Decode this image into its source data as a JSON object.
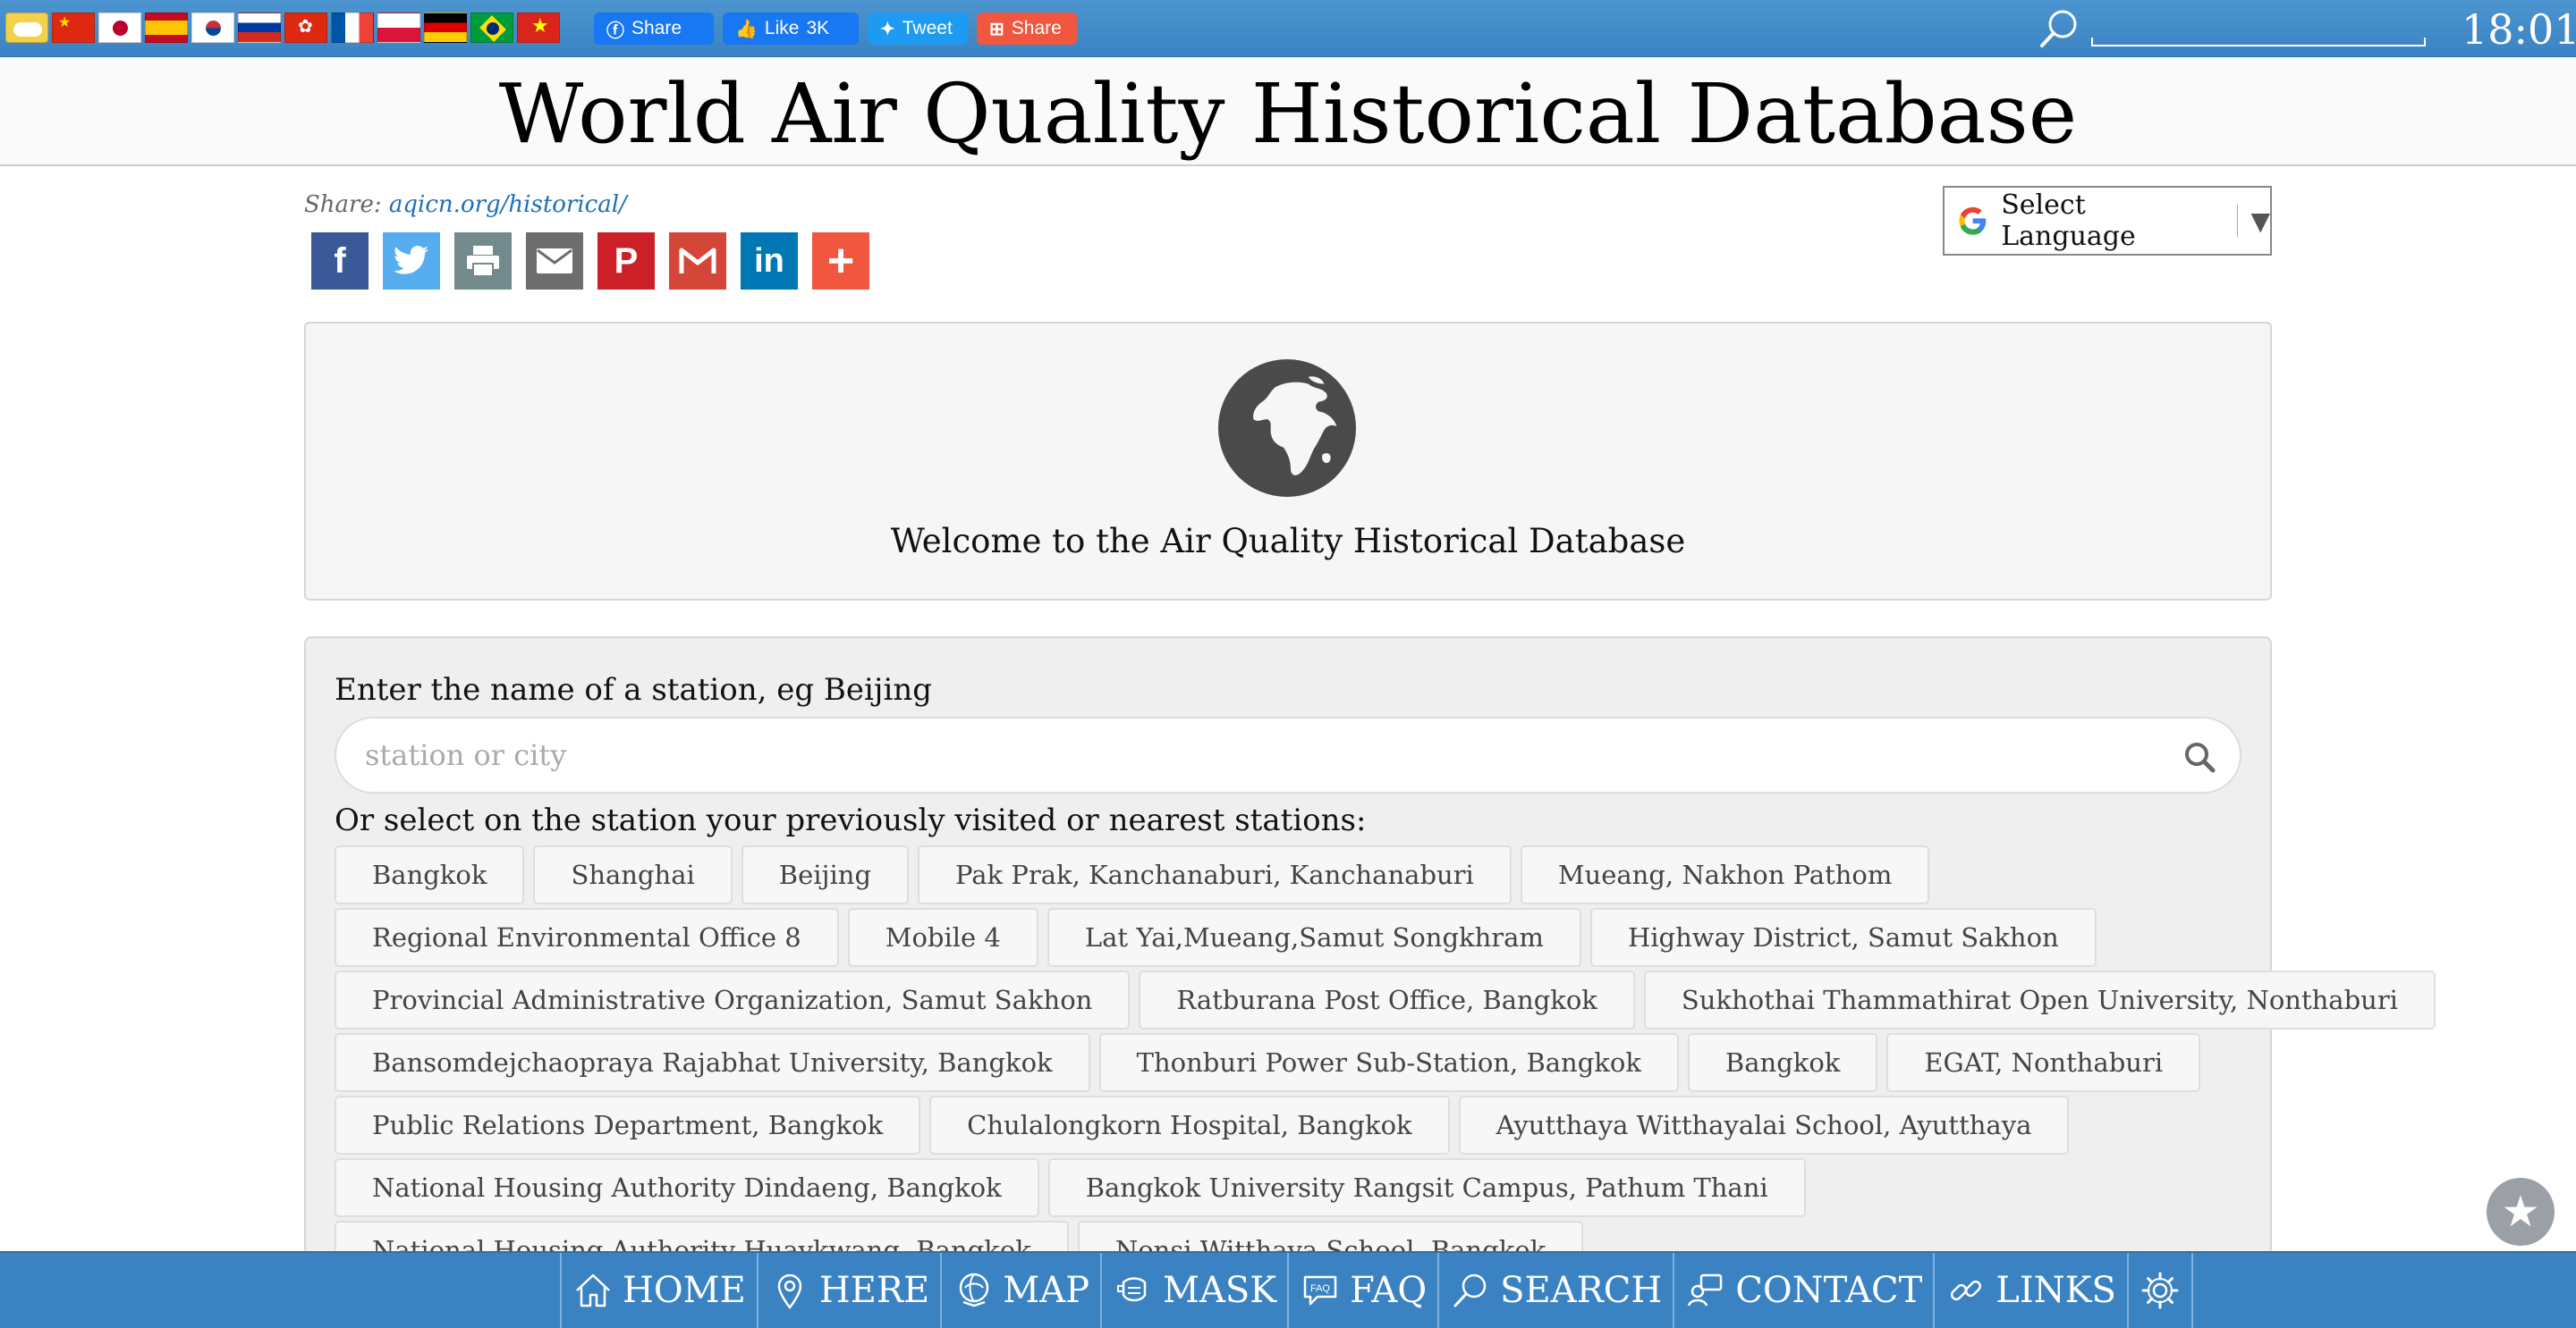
{
  "topbar": {
    "flags": [
      {
        "code": "home"
      },
      {
        "code": "cn"
      },
      {
        "code": "jp"
      },
      {
        "code": "es"
      },
      {
        "code": "kr"
      },
      {
        "code": "ru"
      },
      {
        "code": "hk"
      },
      {
        "code": "fr"
      },
      {
        "code": "pl"
      },
      {
        "code": "de"
      },
      {
        "code": "br"
      },
      {
        "code": "vn"
      }
    ],
    "facebook_share_label": "Share",
    "like_label": "Like",
    "like_count": "3K",
    "tweet_label": "Tweet",
    "addthis_share_label": "Share",
    "clock": "18:01"
  },
  "title": "World Air Quality Historical Database",
  "share": {
    "prefix": "Share:",
    "link": "aqicn.org/historical/",
    "icons": [
      "facebook-icon",
      "twitter-icon",
      "print-icon",
      "email-icon",
      "pinterest-icon",
      "gmail-icon",
      "linkedin-icon",
      "more-icon"
    ]
  },
  "language": {
    "label": "Select Language"
  },
  "welcome": {
    "text": "Welcome to the Air Quality Historical Database"
  },
  "search": {
    "label": "Enter the name of a station, eg Beijing",
    "placeholder": "station or city",
    "value": "",
    "stations_label": "Or select on the station your previously visited or nearest stations:"
  },
  "stations": [
    [
      "Bangkok",
      "Shanghai",
      "Beijing",
      "Pak Prak, Kanchanaburi, Kanchanaburi",
      "Mueang, Nakhon Pathom"
    ],
    [
      "Regional Environmental Office 8",
      "Mobile 4",
      "Lat Yai,Mueang,Samut Songkhram",
      "Highway District, Samut Sakhon"
    ],
    [
      "Provincial Administrative Organization, Samut Sakhon",
      "Ratburana Post Office, Bangkok",
      "Sukhothai Thammathirat Open University, Nonthaburi"
    ],
    [
      "Bansomdejchaopraya Rajabhat University, Bangkok",
      "Thonburi Power Sub-Station, Bangkok",
      "Bangkok",
      "EGAT, Nonthaburi"
    ],
    [
      "Public Relations Department, Bangkok",
      "Chulalongkorn Hospital, Bangkok",
      "Ayutthaya Witthayalai School, Ayutthaya"
    ],
    [
      "National Housing Authority Dindaeng, Bangkok",
      "Bangkok University Rangsit Campus, Pathum Thani"
    ],
    [
      "National Housing Authority Huaykwang, Bangkok",
      "Nonsi Witthaya School, Bangkok"
    ]
  ],
  "nav": {
    "home": "HOME",
    "here": "HERE",
    "map": "MAP",
    "mask": "MASK",
    "faq": "FAQ",
    "search": "SEARCH",
    "contact": "CONTACT",
    "links": "LINKS"
  },
  "colors": {
    "topbar": "#3a82c2",
    "link": "#1e6fb8",
    "facebook": "#3b5998",
    "twitter": "#55acee",
    "print": "#738a8d",
    "email": "#6d6d6d",
    "pinterest": "#cb2027",
    "gmail": "#d44638",
    "linkedin": "#0077b5",
    "more": "#f1563e"
  }
}
